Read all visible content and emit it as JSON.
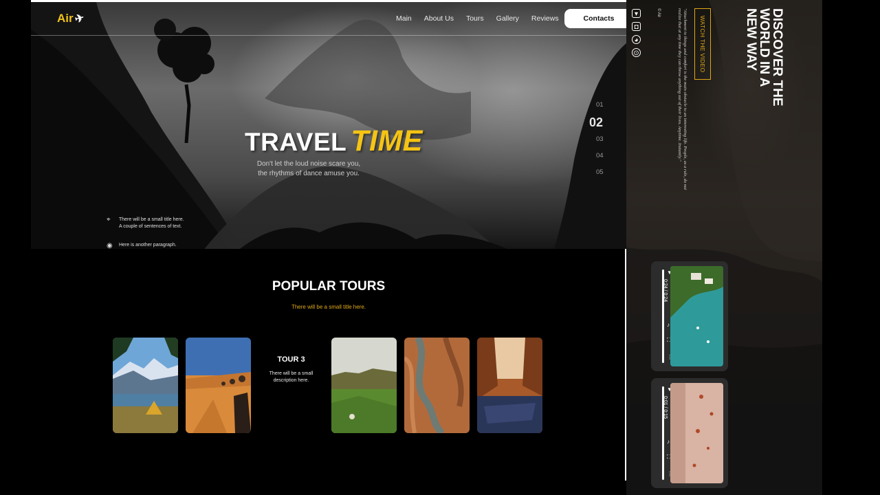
{
  "brand": {
    "logo_text": "Air",
    "logo_icon": "airplane-icon",
    "accent_color": "#f5c414"
  },
  "nav": {
    "items": [
      "Main",
      "About Us",
      "Tours",
      "Gallery",
      "Reviews"
    ],
    "contacts_label": "Contacts"
  },
  "hero": {
    "title_main": "TRAVEL",
    "title_accent": "TIME",
    "subtitle_line1": "Don't let the loud noise scare you,",
    "subtitle_line2": "the rhythms of dance amuse you.",
    "slides": [
      "01",
      "02",
      "03",
      "04",
      "05"
    ],
    "active_slide": "02",
    "info1_line1": "There will be a small title here.",
    "info1_line2": "A couple of sentences of text.",
    "info2": "Here is another paragraph."
  },
  "tours": {
    "title": "POPULAR TOURS",
    "subtitle": "There will be a small title here.",
    "featured_title": "TOUR 3",
    "featured_desc": "There will be a small description here."
  },
  "side": {
    "title": "DISCOVER THE WORLD IN A NEW WAY",
    "watch_label": "WATCH THE VIDEO",
    "quote": "\"Attachment to things and comfort is the main obstacle to an interesting life. People, as a rule, do not realize that at any time they can throw anything out of their lives. Anytime. Instantly.\"",
    "copyright": "© Air",
    "social_icons": [
      "play-icon",
      "instagram-icon",
      "vk-icon",
      "facebook-icon"
    ],
    "video1_time": "0:24 / 0:24",
    "video2_time": "0:01 / 0:15"
  }
}
